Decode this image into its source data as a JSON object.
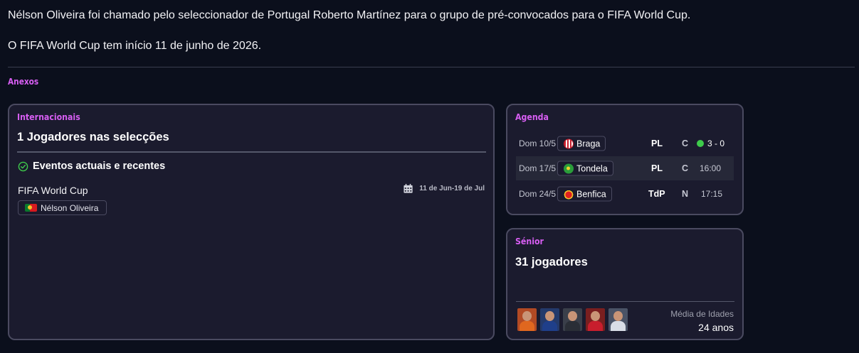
{
  "message": {
    "paragraph1": "Nélson Oliveira foi chamado pelo seleccionador de Portugal Roberto Martínez para o grupo de pré-convocados para o FIFA World Cup.",
    "paragraph2": "O FIFA World Cup tem início 11 de junho de 2026."
  },
  "attachments_heading": "Anexos",
  "internacionais": {
    "title": "Internacionais",
    "heading": "1 Jogadores nas selecções",
    "events_heading": "Eventos actuais e recentes",
    "event": {
      "name": "FIFA World Cup",
      "dates": "11 de Jun-19 de Jul",
      "player": "Nélson Oliveira",
      "player_flag": "portugal-flag-icon"
    }
  },
  "agenda": {
    "title": "Agenda",
    "rows": [
      {
        "date": "Dom 10/5",
        "team": "Braga",
        "crest": "braga-crest-icon",
        "competition": "PL",
        "venue": "C",
        "result": "3 - 0",
        "status": "win"
      },
      {
        "date": "Dom 17/5",
        "team": "Tondela",
        "crest": "tondela-crest-icon",
        "competition": "PL",
        "venue": "C",
        "time": "16:00"
      },
      {
        "date": "Dom 24/5",
        "team": "Benfica",
        "crest": "benfica-crest-icon",
        "competition": "TdP",
        "venue": "N",
        "time": "17:15"
      }
    ]
  },
  "senior": {
    "title": "Sénior",
    "heading": "31 jogadores",
    "avatars": [
      "player-avatar-1",
      "player-avatar-2",
      "player-avatar-3",
      "player-avatar-4",
      "player-avatar-5"
    ],
    "avg_age_label": "Média de Idades",
    "avg_age_value": "24 anos"
  },
  "colors": {
    "accent": "#d75ef2",
    "background": "#0b0f1c",
    "card": "#1b1b2e",
    "win": "#3ecb4b"
  }
}
